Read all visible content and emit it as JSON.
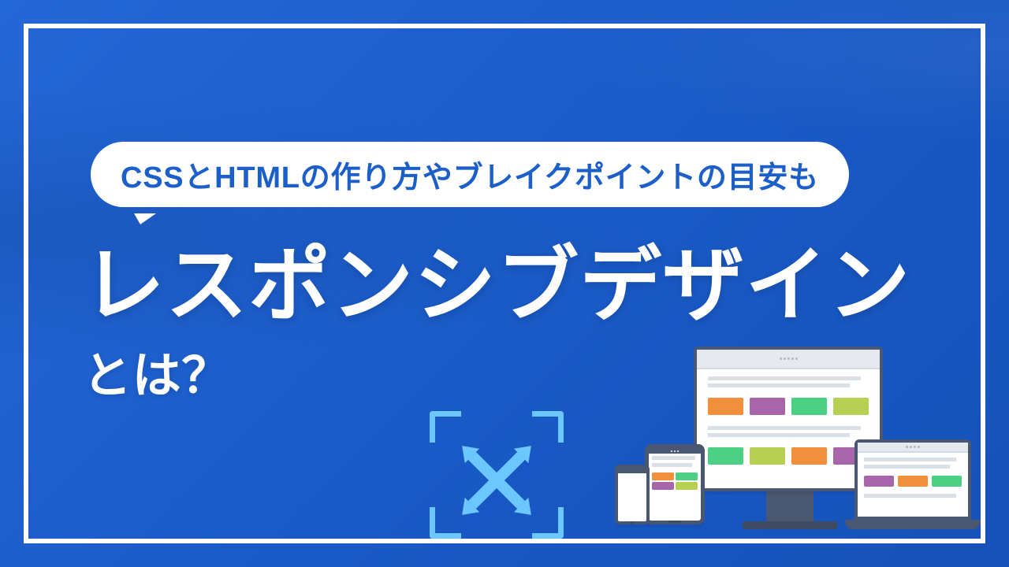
{
  "bubble": "CSSとHTMLの作り方やブレイクポイントの目安も",
  "title": "レスポンシブデザイン",
  "subtitle": "とは？",
  "colors": {
    "bg_primary": "#2467d6",
    "text_white": "#ffffff",
    "bubble_text": "#1c5fc9",
    "icon_arrow": "#6dc7ff",
    "device_frame": "#4a5770"
  },
  "icons": {
    "fullscreen": "fullscreen-expand-icon",
    "devices": [
      "monitor",
      "laptop",
      "tablet",
      "phone"
    ]
  }
}
